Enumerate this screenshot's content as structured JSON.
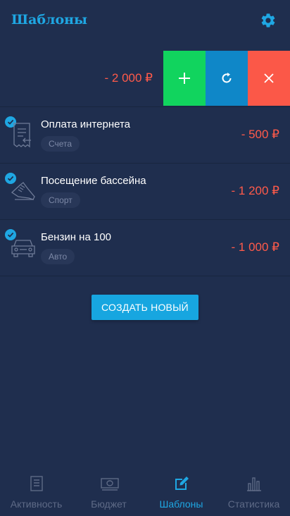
{
  "header": {
    "title": "Шаблоны",
    "settings_icon": "gear-icon"
  },
  "summary": {
    "total": "- 2 000 ₽",
    "actions": [
      {
        "icon": "plus-icon",
        "color": "#11d45e"
      },
      {
        "icon": "repeat-icon",
        "color": "#0f87c8"
      },
      {
        "icon": "close-icon",
        "color": "#fb5848"
      }
    ]
  },
  "templates": [
    {
      "name": "Оплата интернета",
      "category": "Счета",
      "amount": "- 500 ₽",
      "icon": "receipt-icon",
      "checked": true
    },
    {
      "name": "Посещение бассейна",
      "category": "Спорт",
      "amount": "- 1 200 ₽",
      "icon": "sneaker-icon",
      "checked": true
    },
    {
      "name": "Бензин на 100",
      "category": "Авто",
      "amount": "- 1 000 ₽",
      "icon": "car-icon",
      "checked": true
    }
  ],
  "create_button": "СОЗДАТЬ НОВЫЙ",
  "tabs": [
    {
      "label": "Активность",
      "icon": "document-icon",
      "active": false
    },
    {
      "label": "Бюджет",
      "icon": "banknote-icon",
      "active": false
    },
    {
      "label": "Шаблоны",
      "icon": "edit-icon",
      "active": true
    },
    {
      "label": "Статистика",
      "icon": "bar-chart-icon",
      "active": false
    }
  ],
  "colors": {
    "background": "#1f2e4e",
    "accent": "#1fa7e3",
    "negative": "#ff5a4a",
    "muted": "#5e6a86"
  }
}
